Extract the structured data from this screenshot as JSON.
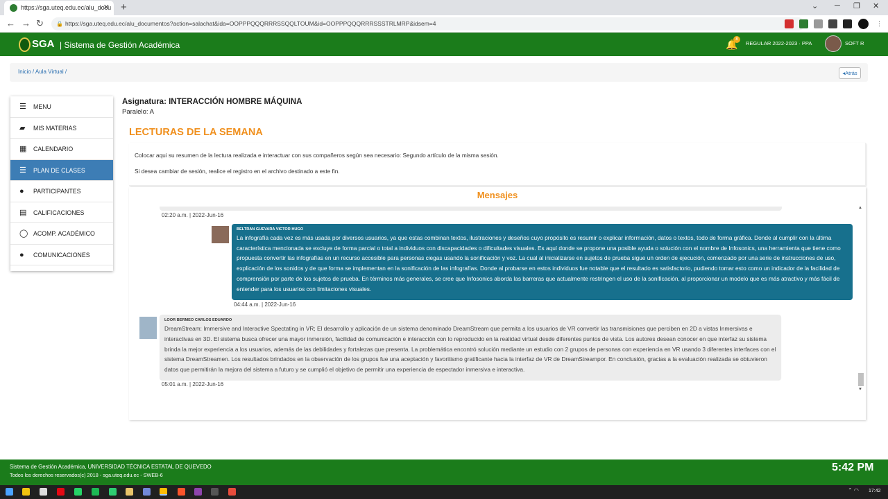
{
  "browser": {
    "tab_title": "https://sga.uteq.edu.ec/alu_docu",
    "new_tab": "+",
    "url": "https://sga.uteq.edu.ec/alu_documentos?action=salachat&ida=OOPPPQQQRRRSSQQLTOUM&id=OOPPPQQQRRRSSSTRLMRP&idsem=4"
  },
  "header": {
    "logo": "SGA",
    "subtitle": "| Sistema de Gestión Académica",
    "notif_count": "8",
    "period": "REGULAR 2022-2023 · PPA",
    "user": "SOFT R"
  },
  "breadcrumb": {
    "text": "Inicio / Aula Virtual /",
    "back": "Atrás"
  },
  "sidebar": {
    "items": [
      {
        "label": "MENU",
        "icon": "list-icon"
      },
      {
        "label": "MIS MATERIAS",
        "icon": "book-icon"
      },
      {
        "label": "CALENDARIO",
        "icon": "calendar-icon"
      },
      {
        "label": "PLAN DE CLASES",
        "icon": "list-icon"
      },
      {
        "label": "PARTICIPANTES",
        "icon": "users-icon"
      },
      {
        "label": "CALIFICACIONES",
        "icon": "table-icon"
      },
      {
        "label": "ACOMP. ACADÉMICO",
        "icon": "comments-icon"
      },
      {
        "label": "COMUNICACIONES",
        "icon": "comment-icon"
      }
    ]
  },
  "main": {
    "subject": "Asignatura: INTERACCIÓN HOMBRE MÁQUINA",
    "paralelo": "Paralelo: A",
    "section_title": "LECTURAS DE LA SEMANA",
    "instruction1": "Colocar aqui su resumen de la lectura realizada e interactuar con sus compañeros según sea necesario: Segundo artículo de la misma sesión.",
    "instruction2": "Si desea cambiar de sesión, realice el registro en el archivo destinado a este fin.",
    "messages_title": "Mensajes",
    "messages": [
      {
        "time": "02:20 a.m. | 2022-Jun-16"
      },
      {
        "author": "BELTRAN GUEVARA VICTOR HUGO",
        "text": "La infografía cada vez es más usada por diversos usuarios, ya que estas combinan textos, ilustraciones y deseños cuyo propósito es resumir o explicar información, datos o textos, todo de forma gráfica. Donde al cumplir con la última característica mencionada se excluye de forma parcial o total a individuos con discapacidades o dificultades visuales. Es aquí donde se propone una posible ayuda o solución con el nombre de Infosonics, una herramienta que tiene como propuesta convertir las infografías en un recurso accesible para personas ciegas usando la sonificación y voz. La cual al inicializarse en sujetos de prueba sigue un orden de ejecución, comenzado por una serie de instrucciones de uso, explicación de los sonidos y de que forma se implementan en la sonificación de las infografías. Donde al probarse en estos individuos fue notable que el resultado es satisfactorio, pudiendo tomar esto como un indicador de la facilidad de comprensión por parte de los sujetos de prueba. En términos más generales, se cree que Infosonics aborda las barreras que actualmente restringen el uso de la sonificación, al proporcionar un modelo que es más atractivo y más fácil de entender para los usuarios con limitaciones visuales.",
        "time": "04:44 a.m. | 2022-Jun-16"
      },
      {
        "author": "LOOR BERMEO CARLOS EDUARDO",
        "text": "DreamStream: Immersive and Interactive Spectating in VR; El desarrollo y aplicación de un sistema denominado DreamStream que permita a los usuarios de VR convertir las transmisiones que perciben en 2D a vistas Inmersivas e interactivas en 3D. El sistema busca ofrecer una mayor inmersión, facilidad de comunicación e interacción con lo reproducido en la realidad virtual desde diferentes puntos de vista. Los autores desean conocer en que interfaz su sistema brinda la mejor experiencia a los usuarios, además de las debilidades y fortalezas que presenta. La problemática encontró solución mediante un estudio con 2 grupos de personas con experiencia en VR usando 3 diferentes interfaces con el sistema DreamStreamen. Los resultados brindados en la observación de los grupos fue una aceptación y favoritismo gratificante hacia la interfaz de VR de DreamStreampor. En conclusión, gracias a la evaluación realizada se obtuvieron datos que permitirán la mejora del sistema a futuro y se cumplió el objetivo de permitir una experiencia de espectador inmersiva e interactiva.",
        "time": "05:01 a.m. | 2022-Jun-16"
      }
    ]
  },
  "footer": {
    "line1": "Sistema de Gestión Académica, UNIVERSIDAD TÉCNICA ESTATAL DE QUEVEDO",
    "line2": "Todos los derechos reservados(c) 2018 - sga.uteq.edu.ec - SWEB-6",
    "clock": "5:42 PM"
  },
  "taskbar": {
    "time": "17:42"
  }
}
